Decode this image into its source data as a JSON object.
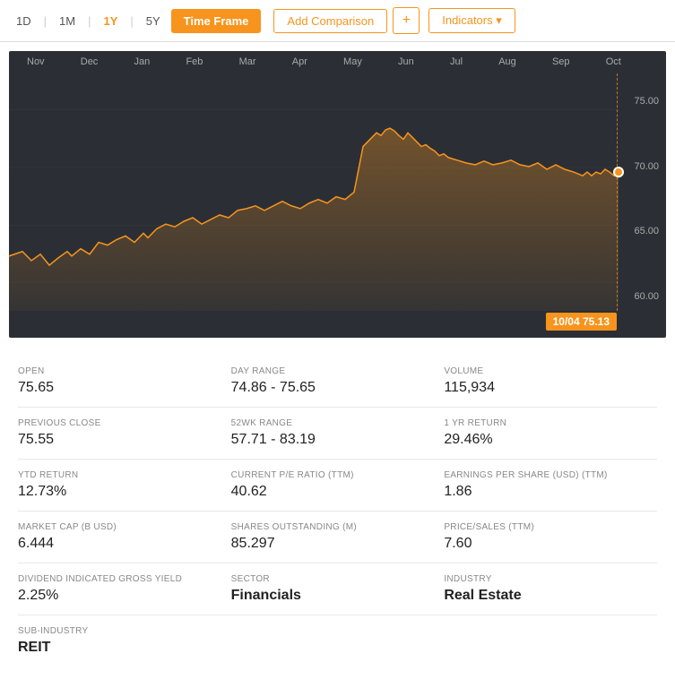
{
  "toolbar": {
    "period_1d": "1D",
    "period_1m": "1M",
    "period_1y": "1Y",
    "period_5y": "5Y",
    "time_frame_label": "Time Frame",
    "add_comparison_label": "Add Comparison",
    "plus_label": "+",
    "indicators_label": "Indicators ▾"
  },
  "chart": {
    "x_labels": [
      "Nov",
      "Dec",
      "Jan",
      "Feb",
      "Mar",
      "Apr",
      "May",
      "Jun",
      "Jul",
      "Aug",
      "Sep",
      "Oct"
    ],
    "y_labels": [
      "75.00",
      "70.00",
      "65.00",
      "60.00"
    ],
    "tooltip_date": "10/04",
    "tooltip_price": "75.13",
    "current_price_label": "75.13"
  },
  "stats": [
    {
      "label": "OPEN",
      "value": "75.65"
    },
    {
      "label": "DAY RANGE",
      "value": "74.86 - 75.65"
    },
    {
      "label": "VOLUME",
      "value": "115,934"
    },
    {
      "label": "PREVIOUS CLOSE",
      "value": "75.55"
    },
    {
      "label": "52WK RANGE",
      "value": "57.71 - 83.19"
    },
    {
      "label": "1 YR RETURN",
      "value": "29.46%"
    },
    {
      "label": "YTD RETURN",
      "value": "12.73%"
    },
    {
      "label": "CURRENT P/E RATIO (TTM)",
      "value": "40.62"
    },
    {
      "label": "EARNINGS PER SHARE (USD) (TTM)",
      "value": "1.86"
    },
    {
      "label": "MARKET CAP (B USD)",
      "value": "6.444"
    },
    {
      "label": "SHARES OUTSTANDING (M)",
      "value": "85.297"
    },
    {
      "label": "PRICE/SALES (TTM)",
      "value": "7.60"
    },
    {
      "label": "DIVIDEND INDICATED GROSS YIELD",
      "value": "2.25%"
    },
    {
      "label": "SECTOR",
      "value": "Financials",
      "bold": true
    },
    {
      "label": "INDUSTRY",
      "value": "Real Estate",
      "bold": true
    },
    {
      "label": "SUB-INDUSTRY",
      "value": "REIT",
      "bold": true,
      "no_border": true
    }
  ]
}
